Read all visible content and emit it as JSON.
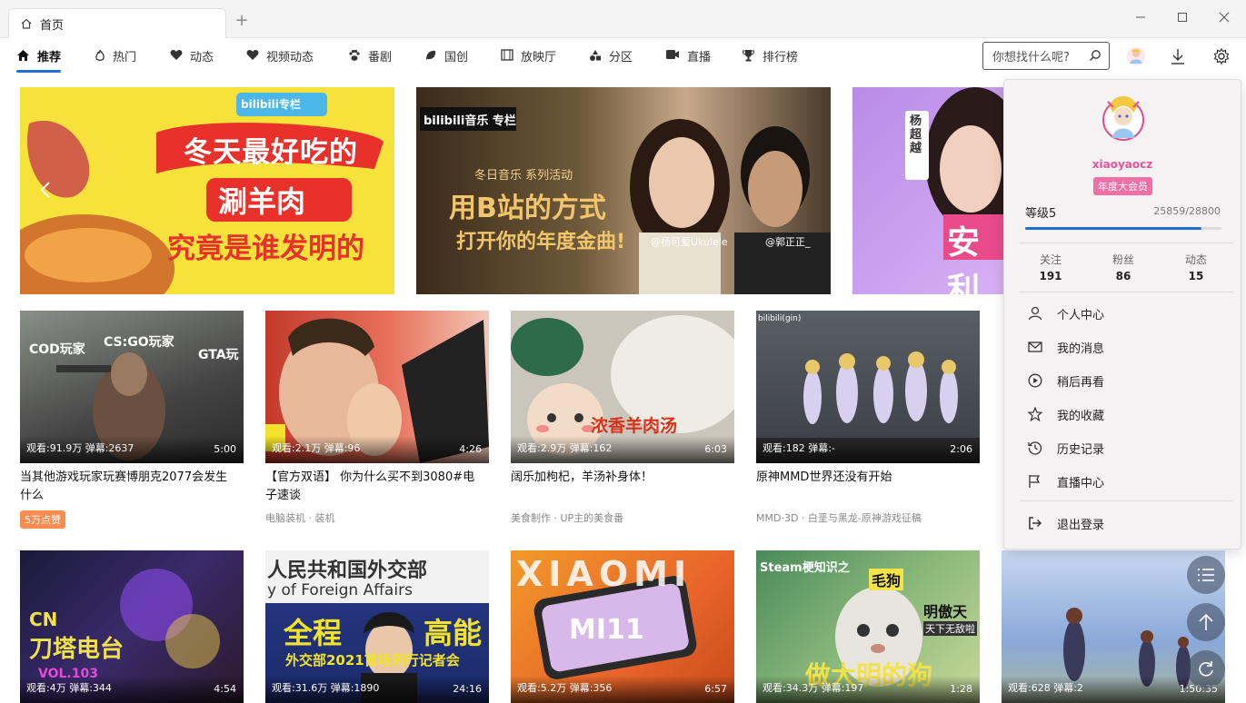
{
  "window": {
    "tab_title": "首页",
    "new_tab": "+"
  },
  "nav": {
    "items": [
      {
        "label": "推荐",
        "icon": "home-icon",
        "active": true
      },
      {
        "label": "热门",
        "icon": "fire-icon"
      },
      {
        "label": "动态",
        "icon": "heart-icon"
      },
      {
        "label": "视频动态",
        "icon": "heart-icon"
      },
      {
        "label": "番剧",
        "icon": "paw-icon"
      },
      {
        "label": "国创",
        "icon": "leaf-icon"
      },
      {
        "label": "放映厅",
        "icon": "film-icon"
      },
      {
        "label": "分区",
        "icon": "shapes-icon"
      },
      {
        "label": "直播",
        "icon": "video-camera-icon"
      },
      {
        "label": "排行榜",
        "icon": "trophy-icon"
      }
    ],
    "search_placeholder": "你想找什么呢?"
  },
  "banners": [
    {
      "headline": [
        "冬天最好吃的",
        "涮羊肉",
        "究竟是谁发明的"
      ],
      "tag": "bilibili专栏"
    },
    {
      "headline": [
        "冬日音乐 系列活动",
        "用B站的方式",
        "打开你的年度金曲!"
      ],
      "tag": "bilibili音乐 专栏",
      "credits": [
        "@杨可爱Ukulele",
        "@郭正正_"
      ]
    },
    {
      "headline": [
        "杨超越",
        "安利"
      ]
    }
  ],
  "videos_row1": [
    {
      "title": "当其他游戏玩家玩赛博朋克2077会发生什么",
      "views": "观看:91.9万",
      "danmaku": "弹幕:2637",
      "duration": "5:00",
      "badge": "5万点赞",
      "thumb_text": [
        "COD玩家",
        "CS:GO玩家",
        "GTA玩"
      ]
    },
    {
      "title": "【官方双语】 你为什么买不到3080#电子速谈",
      "views": "观看:2.1万",
      "danmaku": "弹幕:96",
      "duration": "4:26",
      "meta": "电脑装机 · 装机"
    },
    {
      "title": "阔乐加枸杞，羊汤补身体！",
      "views": "观看:2.9万",
      "danmaku": "弹幕:162",
      "duration": "6:03",
      "meta": "美食制作 · UP主的美食番",
      "thumb_text": [
        "浓香羊肉汤"
      ]
    },
    {
      "title": "原神MMD世界还没有开始",
      "views": "观看:182",
      "danmaku": "弹幕:-",
      "duration": "2:06",
      "meta": "MMD·3D · 白垩与黑龙-原神游戏征稿",
      "thumb_text": [
        "bilibili(gin)"
      ]
    }
  ],
  "videos_row2": [
    {
      "views": "观看:4万",
      "danmaku": "弹幕:344",
      "duration": "4:54",
      "thumb_text": [
        "CN",
        "刀塔电台",
        "VOL.103"
      ]
    },
    {
      "views": "观看:31.6万",
      "danmaku": "弹幕:1890",
      "duration": "24:16",
      "thumb_text": [
        "人民共和国外交部",
        "y of Foreign Affairs",
        "全程",
        "高能",
        "外交部2021首场例行记者会"
      ]
    },
    {
      "views": "观看:5.2万",
      "danmaku": "弹幕:356",
      "duration": "6:57",
      "thumb_text": [
        "XIAOMI",
        "MI11"
      ]
    },
    {
      "views": "观看:34.3万",
      "danmaku": "弹幕:197",
      "duration": "1:28",
      "thumb_text": [
        "Steam梗知识之",
        "毛狗",
        "明傲天",
        "天下无敌啦",
        "做大明的狗"
      ]
    },
    {
      "views": "观看:628",
      "danmaku": "弹幕:2",
      "duration": "1:50:35"
    }
  ],
  "user_panel": {
    "username": "xiaoyaocz",
    "vip_label": "年度大会员",
    "level": "等级5",
    "exp_text": "25859/28800",
    "exp_fraction": 0.898,
    "stats": [
      {
        "label": "关注",
        "value": "191"
      },
      {
        "label": "粉丝",
        "value": "86"
      },
      {
        "label": "动态",
        "value": "15"
      }
    ],
    "menu": [
      {
        "label": "个人中心",
        "icon": "user-icon"
      },
      {
        "label": "我的消息",
        "icon": "mail-icon"
      },
      {
        "label": "稍后再看",
        "icon": "play-circle-icon"
      },
      {
        "label": "我的收藏",
        "icon": "star-icon"
      },
      {
        "label": "历史记录",
        "icon": "history-icon"
      },
      {
        "label": "直播中心",
        "icon": "flag-icon"
      }
    ],
    "logout": "退出登录"
  }
}
